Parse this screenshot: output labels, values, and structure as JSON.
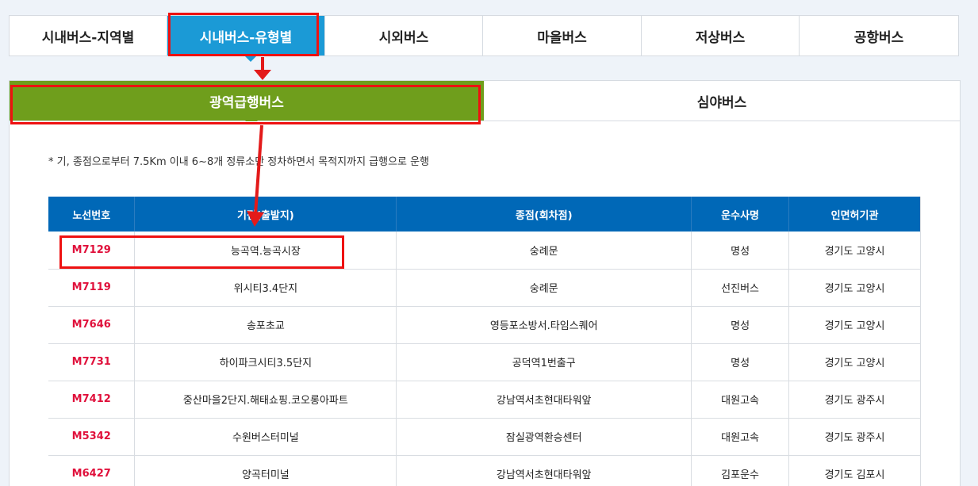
{
  "top_tabs": [
    {
      "label": "시내버스-지역별"
    },
    {
      "label": "시내버스-유형별"
    },
    {
      "label": "시외버스"
    },
    {
      "label": "마을버스"
    },
    {
      "label": "저상버스"
    },
    {
      "label": "공항버스"
    }
  ],
  "sub_tabs": [
    {
      "label": "광역급행버스"
    },
    {
      "label": "심야버스"
    }
  ],
  "note": "* 기, 종점으로부터 7.5Km 이내 6~8개 정류소만 정차하면서 목적지까지 급행으로 운행",
  "table": {
    "headers": [
      "노선번호",
      "기점(출발지)",
      "종점(회차점)",
      "운수사명",
      "인면허기관"
    ],
    "rows": [
      [
        "M7129",
        "능곡역.능곡시장",
        "숭례문",
        "명성",
        "경기도 고양시"
      ],
      [
        "M7119",
        "위시티3.4단지",
        "숭례문",
        "선진버스",
        "경기도 고양시"
      ],
      [
        "M7646",
        "송포초교",
        "영등포소방서.타임스퀘어",
        "명성",
        "경기도 고양시"
      ],
      [
        "M7731",
        "하이파크시티3.5단지",
        "공덕역1번출구",
        "명성",
        "경기도 고양시"
      ],
      [
        "M7412",
        "중산마을2단지.해태쇼핑.코오롱아파트",
        "강남역서초현대타워앞",
        "대원고속",
        "경기도 광주시"
      ],
      [
        "M5342",
        "수원버스터미널",
        "잠실광역환승센터",
        "대원고속",
        "경기도 광주시"
      ],
      [
        "M6427",
        "양곡터미널",
        "강남역서초현대타워앞",
        "김포운수",
        "경기도 김포시"
      ]
    ]
  },
  "colors": {
    "active_tab": "#1b9ad6",
    "active_subtab": "#6f9e1c",
    "table_header": "#0068b7",
    "route_number": "#e0103b",
    "highlight": "#ee1111"
  }
}
